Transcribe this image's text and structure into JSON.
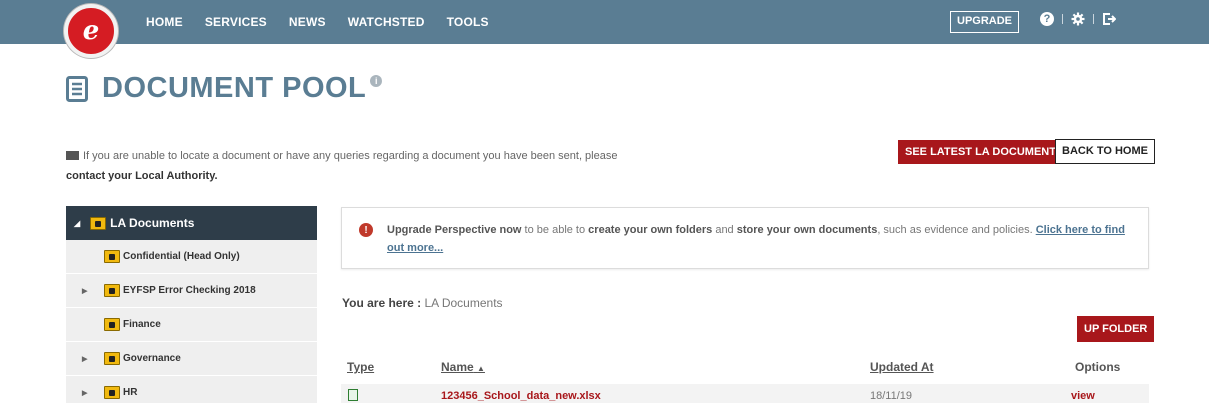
{
  "nav": {
    "logo_letter": "e",
    "items": [
      "HOME",
      "SERVICES",
      "NEWS",
      "WATCHSTED",
      "TOOLS"
    ],
    "upgrade_label": "UPGRADE",
    "help_glyph": "?"
  },
  "page": {
    "title": "DOCUMENT POOL",
    "info_glyph": "i"
  },
  "notice": {
    "text": "If you are unable to locate a document or have any queries regarding a document you have been sent, please",
    "contact": "contact your Local Authority."
  },
  "buttons": {
    "latest": "SEE LATEST LA DOCUMENTS",
    "back": "BACK TO HOME",
    "up_folder": "UP FOLDER"
  },
  "tree": {
    "root": "LA Documents",
    "items": [
      {
        "label": "Confidential (Head Only)",
        "expandable": false
      },
      {
        "label": "EYFSP Error Checking 2018",
        "expandable": true
      },
      {
        "label": "Finance",
        "expandable": false
      },
      {
        "label": "Governance",
        "expandable": true
      },
      {
        "label": "HR",
        "expandable": true
      }
    ]
  },
  "upgrade_box": {
    "lead": "Upgrade Perspective now",
    "mid1": " to be able to ",
    "bold1": "create your own folders",
    "mid2": " and ",
    "bold2": "store your own documents",
    "mid3": ", such as evidence and policies. ",
    "link": "Click here to find out more..."
  },
  "breadcrumb": {
    "label": "You are here :",
    "path": "LA Documents"
  },
  "table": {
    "headers": {
      "type": "Type",
      "name": "Name",
      "updated": "Updated At",
      "options": "Options"
    },
    "rows": [
      {
        "name": "123456_School_data_new.xlsx",
        "updated": "18/11/19",
        "option": "view"
      }
    ]
  },
  "colors": {
    "topbar": "#5a7d93",
    "accent_red": "#a8171b",
    "tree_header": "#2e3d49"
  }
}
